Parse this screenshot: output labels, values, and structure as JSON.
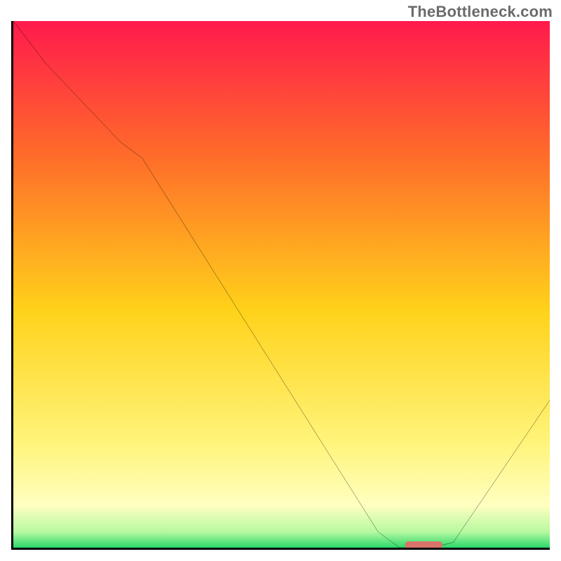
{
  "watermark": "TheBottleneck.com",
  "chart_data": {
    "type": "line",
    "title": "",
    "xlabel": "",
    "ylabel": "",
    "xlim": [
      0,
      100
    ],
    "ylim": [
      0,
      100
    ],
    "series": [
      {
        "name": "bottleneck-curve",
        "x": [
          0,
          6,
          20,
          24,
          68,
          72,
          78,
          82,
          100
        ],
        "y": [
          100,
          92,
          77,
          74,
          3,
          0,
          0,
          1,
          28
        ]
      }
    ],
    "marker": {
      "name": "sweet-spot",
      "x_start": 73,
      "x_end": 80,
      "y": 0.5,
      "color": "#d9736a"
    },
    "background": {
      "type": "vertical-gradient",
      "stops": [
        {
          "pos": 0,
          "color": "#ff1a4d"
        },
        {
          "pos": 25,
          "color": "#ff6a2a"
        },
        {
          "pos": 55,
          "color": "#ffd21a"
        },
        {
          "pos": 80,
          "color": "#fff47a"
        },
        {
          "pos": 92,
          "color": "#ffffc0"
        },
        {
          "pos": 97,
          "color": "#b6f9a0"
        },
        {
          "pos": 100,
          "color": "#2bd86b"
        }
      ]
    }
  }
}
